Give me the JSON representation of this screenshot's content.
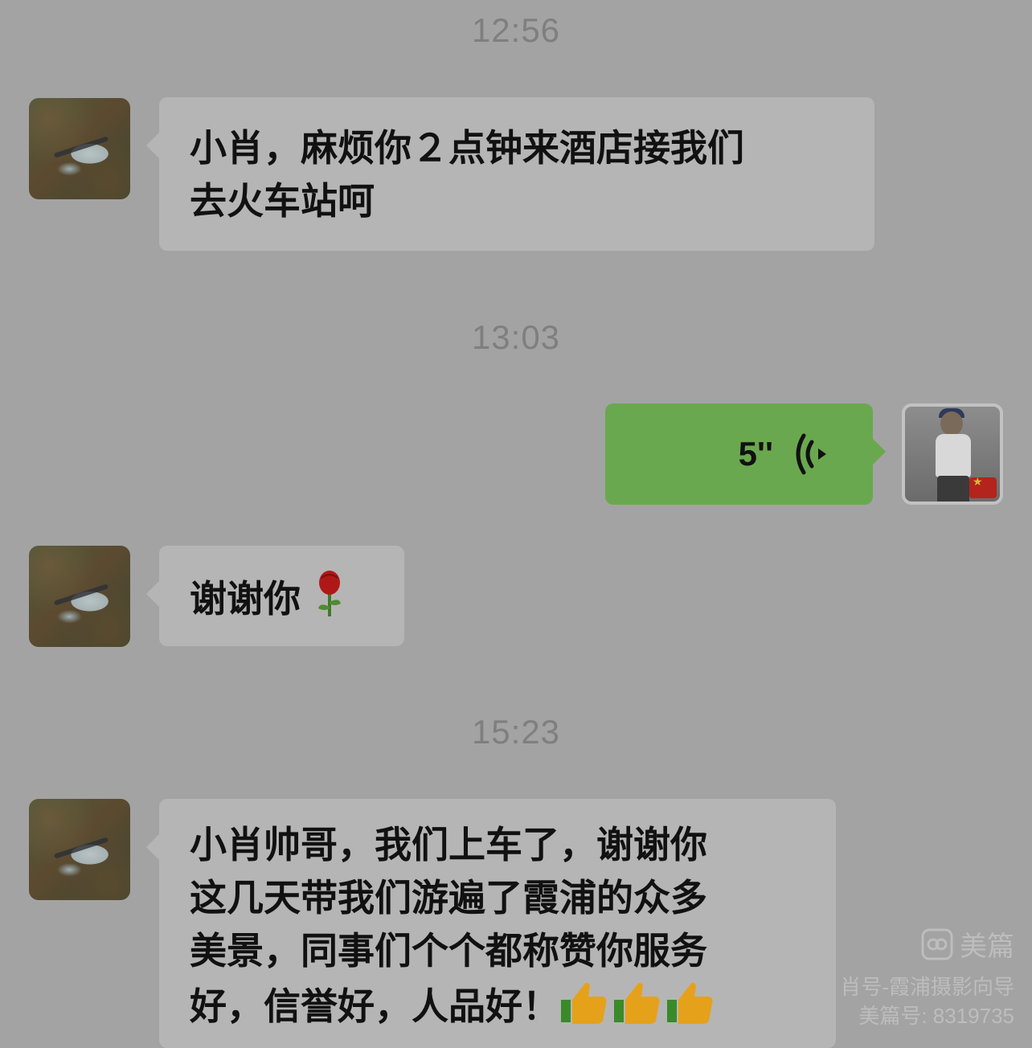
{
  "timestamps": [
    "12:56",
    "13:03",
    "15:23"
  ],
  "messages": [
    {
      "sender": "other",
      "text_lines": [
        "小肖，麻烦你２点钟来酒店接我们",
        "去火车站呵"
      ]
    },
    {
      "sender": "self",
      "type": "voice",
      "duration": "5''"
    },
    {
      "sender": "other",
      "text": "谢谢你",
      "emoji": "rose"
    },
    {
      "sender": "other",
      "text_lines": [
        "小肖帅哥，我们上车了，谢谢你",
        "这几天带我们游遍了霞浦的众多",
        "美景，同事们个个都称赞你服务",
        "好，信誉好，人品好！"
      ],
      "emoji": "thumbs-up x3"
    }
  ],
  "watermark": {
    "brand": "美篇",
    "line1": "肖号-霞浦摄影向导",
    "line2": "美篇号: 8319735"
  },
  "colors": {
    "background": "#a3a3a3",
    "bubble_received": "#b5b5b5",
    "bubble_sent": "#6aa84f",
    "timestamp": "#7f7f7f"
  }
}
